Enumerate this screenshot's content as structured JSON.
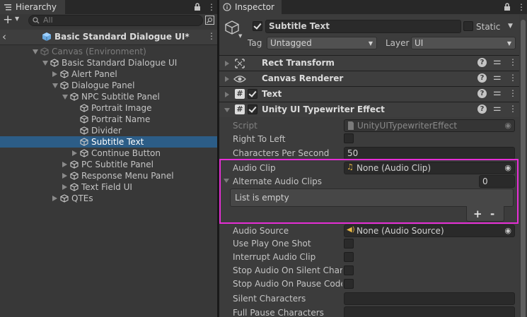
{
  "hierarchy": {
    "tab_label": "Hierarchy",
    "search_placeholder": "All",
    "scene_title": "Basic Standard Dialogue UI*",
    "tree": [
      {
        "label": "Canvas (Environment)",
        "depth": 0,
        "expanded": true,
        "dim": true
      },
      {
        "label": "Basic Standard Dialogue UI",
        "depth": 1,
        "expanded": true
      },
      {
        "label": "Alert Panel",
        "depth": 2,
        "expanded": false
      },
      {
        "label": "Dialogue Panel",
        "depth": 2,
        "expanded": true
      },
      {
        "label": "NPC Subtitle Panel",
        "depth": 3,
        "expanded": true
      },
      {
        "label": "Portrait Image",
        "depth": 4,
        "leaf": true
      },
      {
        "label": "Portrait Name",
        "depth": 4,
        "leaf": true
      },
      {
        "label": "Divider",
        "depth": 4,
        "leaf": true
      },
      {
        "label": "Subtitle Text",
        "depth": 4,
        "leaf": true,
        "selected": true
      },
      {
        "label": "Continue Button",
        "depth": 4,
        "expanded": false
      },
      {
        "label": "PC Subtitle Panel",
        "depth": 3,
        "expanded": false
      },
      {
        "label": "Response Menu Panel",
        "depth": 3,
        "expanded": false
      },
      {
        "label": "Text Field UI",
        "depth": 3,
        "expanded": false
      },
      {
        "label": "QTEs",
        "depth": 2,
        "expanded": false
      }
    ]
  },
  "inspector": {
    "tab_label": "Inspector",
    "object_name": "Subtitle Text",
    "static_label": "Static",
    "tag_label": "Tag",
    "tag_value": "Untagged",
    "layer_label": "Layer",
    "layer_value": "UI",
    "components": {
      "rect_transform": "Rect Transform",
      "canvas_renderer": "Canvas Renderer",
      "text": "Text",
      "typewriter": "Unity UI Typewriter Effect"
    },
    "props": {
      "script_label": "Script",
      "script_value": "UnityUITypewriterEffect",
      "rtl_label": "Right To Left",
      "cps_label": "Characters Per Second",
      "cps_value": "50",
      "audio_clip_label": "Audio Clip",
      "audio_clip_value": "None (Audio Clip)",
      "alt_clips_label": "Alternate Audio Clips",
      "alt_clips_count": "0",
      "list_empty": "List is empty",
      "plus": "+",
      "minus": "-",
      "audio_source_label": "Audio Source",
      "audio_source_value": "None (Audio Source)",
      "play_one_shot_label": "Use Play One Shot",
      "interrupt_label": "Interrupt Audio Clip",
      "stop_silent_label": "Stop Audio On Silent Chara",
      "stop_pause_label": "Stop Audio On Pause Codes",
      "silent_chars_label": "Silent Characters",
      "full_pause_label": "Full Pause Characters"
    }
  },
  "colors": {
    "highlight": "#e62ed6",
    "selection": "#2c5d87"
  }
}
